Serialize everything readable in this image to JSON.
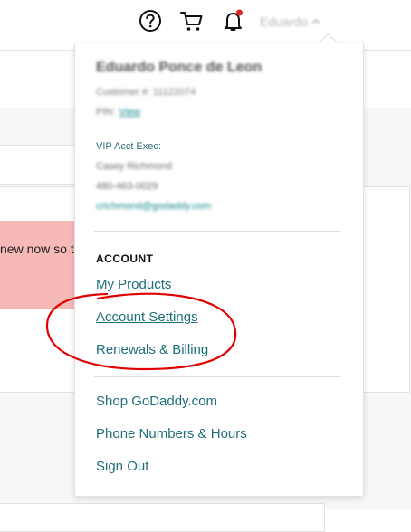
{
  "background": {
    "alert_text": "new now so t"
  },
  "header": {
    "icons": [
      "help-icon",
      "cart-icon",
      "bell-icon"
    ],
    "user_name": "Eduardo",
    "notification_color": "#e02424"
  },
  "dropdown": {
    "account_name": "Eduardo Ponce de Leon",
    "customer_line": "Customer #: 11122074",
    "pin_label": "PIN:",
    "pin_link": "View",
    "vip_label": "VIP Acct Exec:",
    "exec_name": "Casey Richmond",
    "exec_phone": "480-463-0029",
    "exec_email": "crichmond@godaddy.com",
    "section_heading": "ACCOUNT",
    "account_links": [
      "My Products",
      "Account Settings",
      "Renewals & Billing"
    ],
    "other_links": [
      "Shop GoDaddy.com",
      "Phone Numbers & Hours",
      "Sign Out"
    ]
  },
  "colors": {
    "link": "#1f6f78",
    "annotation": "#e00000",
    "alert_bg": "#f7b8b8"
  }
}
